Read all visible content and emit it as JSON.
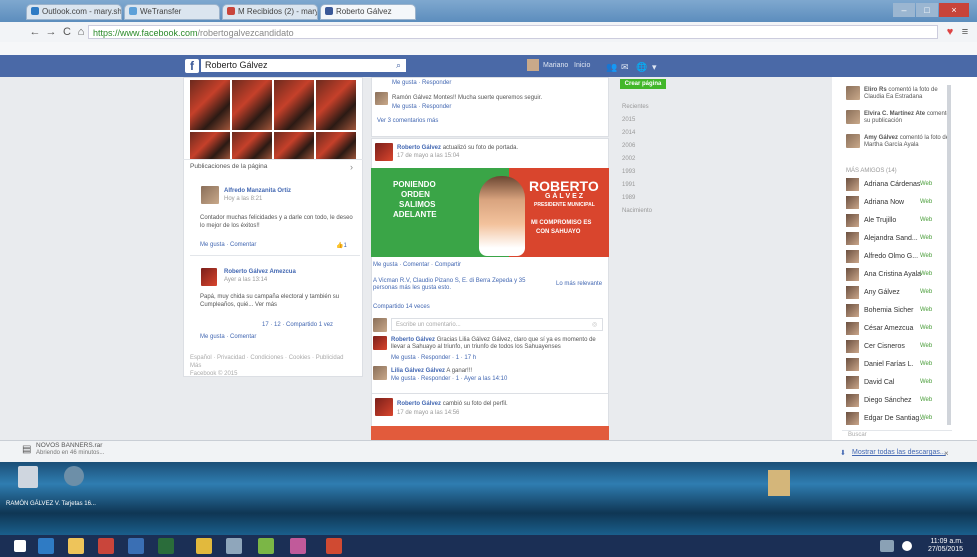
{
  "browser": {
    "tabs": [
      {
        "label": "Outlook.com - mary.sh...",
        "color": "#2f7bc4"
      },
      {
        "label": "WeTransfer",
        "color": "#5da0d8"
      },
      {
        "label": "M Recibidos (2) - maryammi...",
        "color": "#c9453b"
      },
      {
        "label": "Roberto Gálvez",
        "color": "#3b5998"
      }
    ],
    "url_secure": "https://www.facebook.com",
    "url_path": "/robertogalvezcandidato"
  },
  "facebook": {
    "logo": "f",
    "search_value": "Roberto Gálvez",
    "nav_user": "Mariano",
    "nav_home": "Inicio",
    "nav_create_page": "Crear página"
  },
  "left_column": {
    "section_title": "Publicaciones de la página",
    "post1": {
      "author": "Alfredo Manzanita Ortiz",
      "time": "Hoy a las 8:21",
      "text": "Contador muchas felicidades y a darle con todo, le deseo lo mejor de los éxitos!!",
      "actions": "Me gusta · Comentar"
    },
    "post2": {
      "author": "Roberto Gálvez Amezcua",
      "time": "Ayer a las 13:14",
      "text": "Papá, muy chida su campaña electoral y también su Cumpleaños, quié... Ver más",
      "stats": "17 · 12 · Compartido 1 vez",
      "actions": "Me gusta · Comentar"
    },
    "footer": "Español · Privacidad · Condiciones · Cookies · Publicidad",
    "footer2": "Más",
    "footer3": "Facebook © 2015"
  },
  "feed": {
    "top_actions": "Me gusta · Responder",
    "top_comment": "Ramón Gálvez Montes!! Mucha suerte queremos seguir.",
    "see_comments": "Ver 3 comentarios más",
    "post_author": "Roberto Gálvez",
    "post_action": "actualizó su foto de portada.",
    "post_time": "17 de mayo a las 15:04",
    "banner": {
      "left_line1": "PONIENDO",
      "left_line2": "ORDEN",
      "left_line3": "SALIMOS",
      "left_line4": "ADELANTE",
      "name1": "ROBERTO",
      "name2": "G Á L V E Z",
      "role": "PRESIDENTE MUNICIPAL",
      "slogan1": "MI COMPROMISO ES",
      "slogan2": "CON SAHUAYO"
    },
    "post_actions": "Me gusta · Comentar · Compartir",
    "likes": "A Vicman R.V, Claudio Pizano S, E. di Berra Zepeda y 35 personas más les gusta esto.",
    "most_relevant": "Lo más relevante",
    "shares": "Compartido 14 veces",
    "write_comment": "Escribe un comentario...",
    "comment1_author": "Roberto Gálvez",
    "comment1_text": "Gracias Lilia Gálvez Gálvez, claro que sí ya es momento de llevar a Sahuayo al triunfo, un triunfo de todos los Sahuayenses",
    "comment1_actions": "Me gusta · Responder · 1 · 17 h",
    "comment2_author": "Lilia Gálvez Gálvez",
    "comment2_text": "A ganar!!!",
    "comment2_actions": "Me gusta · Responder · 1 · Ayer a las 14:10",
    "post2_author": "Roberto Gálvez",
    "post2_action": "cambió su foto del perfil.",
    "post2_time": "17 de mayo a las 14:56"
  },
  "years": [
    "Recientes",
    "2015",
    "2014",
    "2006",
    "2002",
    "1993",
    "1991",
    "1989",
    "Nacimiento"
  ],
  "ticker": [
    {
      "name": "Eliro Rs",
      "text": "comentó la foto de Claudia Ea Estradana"
    },
    {
      "name": "Elvira C. Martínez Ate",
      "text": "comentó su publicación"
    },
    {
      "name": "Amy Gálvez",
      "text": "comentó la foto de Martha García Ayala"
    }
  ],
  "more_contacts_label": "MÁS AMIGOS (14)",
  "contacts": [
    "Adriana Cárdenas",
    "Adriana Now",
    "Ale Trujillo",
    "Alejandra Sand...",
    "Alfredo Olmo G...",
    "Ana Cristina Ayala",
    "Any Gálvez",
    "Bohemia Sicher",
    "César Amezcua",
    "Cer Cisneros",
    "Daniel Farías L.",
    "David Cal",
    "Diego Sánchez",
    "Edgar De Santiag..."
  ],
  "contact_status": "Web",
  "chat_search": "Buscar",
  "download": {
    "filename": "NOVOS BANNERS.rar",
    "status": "Abriendo en 46 minutos...",
    "show_all": "Mostrar todas las descargas..."
  },
  "desktop": {
    "icon_label": "RAMÓN GÁLVEZ V. Tarjetas 16..."
  },
  "clock": {
    "time": "11:09 a.m.",
    "date": "27/05/2015"
  }
}
